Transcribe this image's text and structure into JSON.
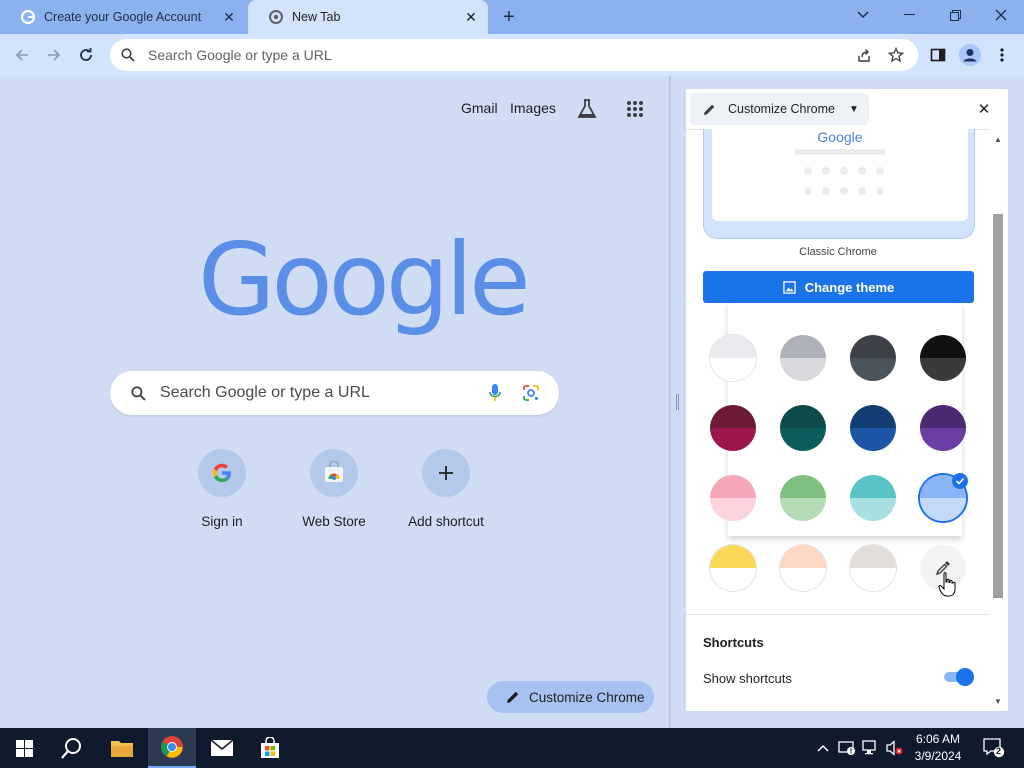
{
  "browser": {
    "tabs": [
      {
        "title": "Create your Google Account"
      },
      {
        "title": "New Tab"
      }
    ],
    "omnibox_placeholder": "Search Google or type a URL"
  },
  "ntp": {
    "links": {
      "gmail": "Gmail",
      "images": "Images"
    },
    "logo": "Google",
    "search_placeholder": "Search Google or type a URL",
    "shortcuts": [
      {
        "label": "Sign in"
      },
      {
        "label": "Web Store"
      },
      {
        "label": "Add shortcut"
      }
    ],
    "customize_button": "Customize Chrome"
  },
  "side_panel": {
    "title": "Customize Chrome",
    "preview_logo": "Google",
    "theme_name": "Classic Chrome",
    "change_theme_label": "Change theme",
    "color_swatches": [
      {
        "name": "grey-light",
        "top": "#e8eaed",
        "bottom": "#ffffff",
        "selected": false
      },
      {
        "name": "grey",
        "top": "#aeb3bb",
        "bottom": "#d7d9dd",
        "selected": false
      },
      {
        "name": "dark-slate",
        "top": "#3c4247",
        "bottom": "#4a545c",
        "selected": false
      },
      {
        "name": "black",
        "top": "#111111",
        "bottom": "#3a3a3a",
        "selected": false
      },
      {
        "name": "burgundy",
        "top": "#6e1b3a",
        "bottom": "#9c1750",
        "selected": false
      },
      {
        "name": "dark-teal",
        "top": "#0f4a4a",
        "bottom": "#0d5e5a",
        "selected": false
      },
      {
        "name": "navy",
        "top": "#123e73",
        "bottom": "#1a56a3",
        "selected": false
      },
      {
        "name": "purple",
        "top": "#4a2a73",
        "bottom": "#6a3ea3",
        "selected": false
      },
      {
        "name": "pink",
        "top": "#f7a8b8",
        "bottom": "#fbd3db",
        "selected": false
      },
      {
        "name": "green",
        "top": "#7fbf7f",
        "bottom": "#b5dcb5",
        "selected": false
      },
      {
        "name": "aqua",
        "top": "#5ac3c6",
        "bottom": "#a8e0e1",
        "selected": false
      },
      {
        "name": "blue",
        "top": "#8ab4f8",
        "bottom": "#c5d9fb",
        "selected": true
      },
      {
        "name": "yellow",
        "top": "#f9d858",
        "bottom": "#ffffff",
        "selected": false
      },
      {
        "name": "peach",
        "top": "#fbd7c4",
        "bottom": "#ffffff",
        "selected": false
      },
      {
        "name": "beige",
        "top": "#e2ddd8",
        "bottom": "#ffffff",
        "selected": false
      }
    ],
    "shortcuts_section_title": "Shortcuts",
    "show_shortcuts_label": "Show shortcuts",
    "show_shortcuts_enabled": true
  },
  "taskbar": {
    "time": "6:06 AM",
    "date": "3/9/2024",
    "notification_count": "2"
  },
  "colors": {
    "accent": "#1a73e8",
    "tabstrip": "#8cb1ef",
    "toolbar": "#d3e3fd",
    "ntp_background": "#cfdcf3",
    "logo": "#5b8ee6"
  }
}
